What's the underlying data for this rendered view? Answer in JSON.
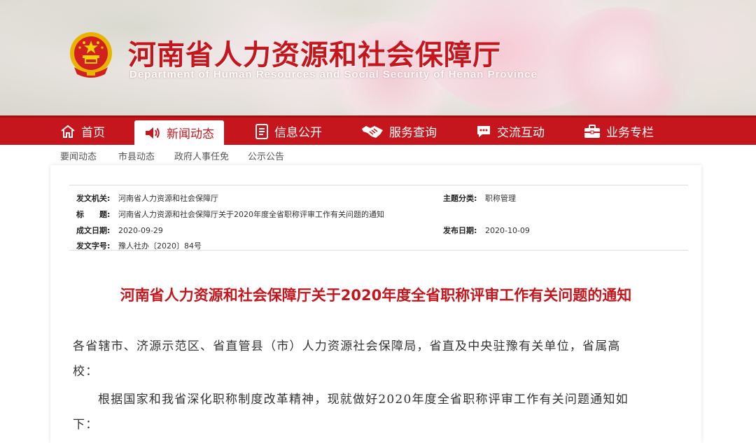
{
  "header": {
    "title": "河南省人力资源和社会保障厅",
    "subtitle_en": "Department of Human Resources and Social Security of Henan Province"
  },
  "nav": {
    "items": [
      {
        "label": "首页",
        "icon": "home-icon"
      },
      {
        "label": "新闻动态",
        "icon": "speaker-icon"
      },
      {
        "label": "信息公开",
        "icon": "document-icon"
      },
      {
        "label": "服务查询",
        "icon": "handshake-icon"
      },
      {
        "label": "交流互动",
        "icon": "chat-icon"
      },
      {
        "label": "业务专栏",
        "icon": "briefcase-icon"
      }
    ],
    "active": "新闻动态"
  },
  "subnav": {
    "items": [
      "要闻动态",
      "市县动态",
      "政府人事任免",
      "公示公告"
    ]
  },
  "meta": {
    "issuer_label": "发文机关:",
    "issuer": "河南省人力资源和社会保障厅",
    "category_label": "主题分类:",
    "category": "职称管理",
    "title_label": "标　　题:",
    "title": "河南省人力资源和社会保障厅关于2020年度全省职称评审工作有关问题的通知",
    "date_label": "成文日期:",
    "date": "2020-09-29",
    "publish_label": "发布日期:",
    "publish": "2020-10-09",
    "docno_label": "发文字号:",
    "docno": "豫人社办〔2020〕84号"
  },
  "article": {
    "title": "河南省人力资源和社会保障厅关于2020年度全省职称评审工作有关问题的通知",
    "para1_line1": "各省辖市、济源示范区、省直管县（市）人力资源社会保障局，省直及中央驻豫有关单位，省属高",
    "para1_line2": "校：",
    "para2_line1": "根据国家和我省深化职称制度改革精神，现就做好2020年度全省职称评审工作有关问题通知如",
    "para2_line2": "下："
  },
  "colors": {
    "brand_red": "#c4161c",
    "text": "#333333"
  }
}
